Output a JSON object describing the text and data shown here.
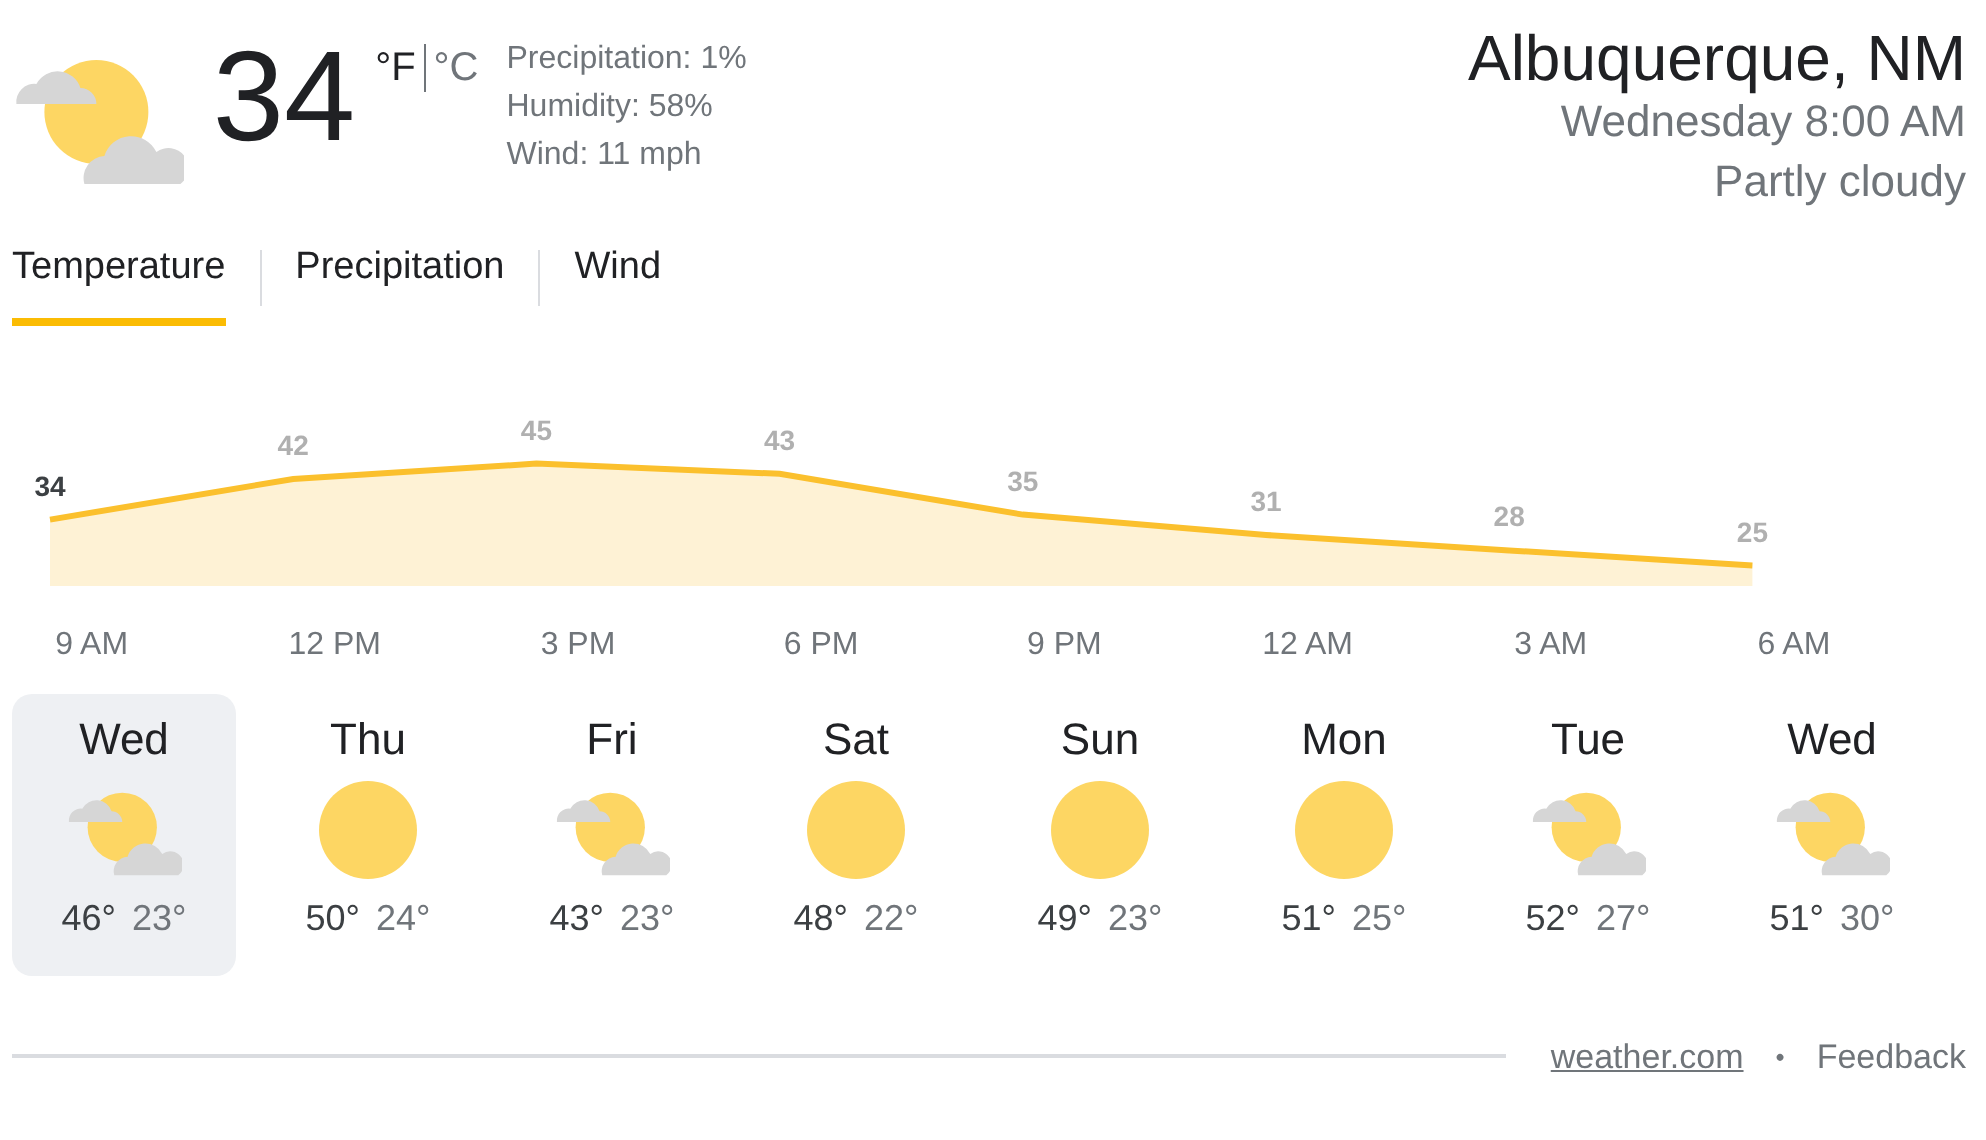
{
  "current": {
    "kind": "partly-cloudy",
    "temperature": "34",
    "unit_f": {
      "label": "°F",
      "selected": true
    },
    "unit_c": {
      "label": "°C",
      "selected": false
    },
    "details": [
      "Precipitation: 1%",
      "Humidity: 58%",
      "Wind: 11 mph"
    ]
  },
  "location": {
    "city": "Albuquerque, NM",
    "time": "Wednesday 8:00 AM",
    "condition": "Partly cloudy"
  },
  "tabs": [
    {
      "label": "Temperature",
      "selected": true
    },
    {
      "label": "Precipitation",
      "selected": false
    },
    {
      "label": "Wind",
      "selected": false
    }
  ],
  "chart": {
    "chart_data": {
      "type": "area",
      "categories": [
        "9 AM",
        "12 PM",
        "3 PM",
        "6 PM",
        "9 PM",
        "12 AM",
        "3 AM",
        "6 AM"
      ],
      "series": [
        {
          "color": "#fbc02d",
          "values": [
            34,
            42,
            45,
            43,
            35,
            31,
            28,
            25
          ]
        }
      ],
      "data_labels": true
    }
  },
  "days": [
    {
      "day": "Wed",
      "kind": "partly-cloudy",
      "high": "46°",
      "low": "23°",
      "selected": true
    },
    {
      "day": "Thu",
      "kind": "sunny",
      "high": "50°",
      "low": "24°",
      "selected": false
    },
    {
      "day": "Fri",
      "kind": "partly-cloudy",
      "high": "43°",
      "low": "23°",
      "selected": false
    },
    {
      "day": "Sat",
      "kind": "sunny",
      "high": "48°",
      "low": "22°",
      "selected": false
    },
    {
      "day": "Sun",
      "kind": "sunny",
      "high": "49°",
      "low": "23°",
      "selected": false
    },
    {
      "day": "Mon",
      "kind": "sunny",
      "high": "51°",
      "low": "25°",
      "selected": false
    },
    {
      "day": "Tue",
      "kind": "partly-cloudy",
      "high": "52°",
      "low": "27°",
      "selected": false
    },
    {
      "day": "Wed",
      "kind": "partly-cloudy",
      "high": "51°",
      "low": "30°",
      "selected": false
    }
  ],
  "footer": {
    "source_link": "weather.com",
    "separator": "•",
    "feedback": "Feedback"
  }
}
